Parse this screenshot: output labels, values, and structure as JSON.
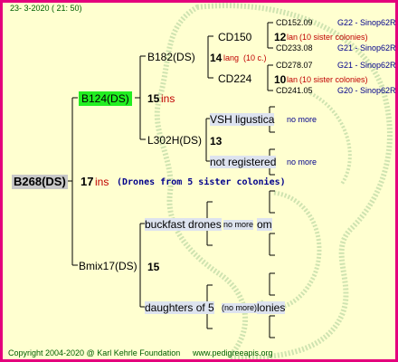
{
  "header": {
    "date": "23- 3-2020 ( 21: 50)"
  },
  "root": {
    "id": "B268(DS)",
    "num": "17",
    "suffix": "ins",
    "note": "(Drones from 5 sister colonies)"
  },
  "queen": {
    "id": "B124(DS)",
    "num": "15",
    "suffix": "ins"
  },
  "queen_mother": {
    "id": "B182(DS)",
    "num": "14",
    "suffix": "lang",
    "note": "(10 c.)"
  },
  "queen_father": {
    "id": "L302H(DS)",
    "num": "13"
  },
  "qm_mother": {
    "id": "CD150",
    "num": "12",
    "suffix": "lan",
    "note": "(10 sister colonies)"
  },
  "qm_father": {
    "id": "CD224",
    "num": "10",
    "suffix": "lan",
    "note": "(10 sister colonies)"
  },
  "great": [
    {
      "id": "CD152.09",
      "ref": "G22 - Sinop62R"
    },
    {
      "id": "CD233.08",
      "ref": "G21 - Sinop62R"
    },
    {
      "id": "CD278.07",
      "ref": "G21 - Sinop62R"
    },
    {
      "id": "CD241.05",
      "ref": "G20 - Sinop62R"
    }
  ],
  "qf_mother": {
    "id": "VSH ligustica",
    "more": "no more"
  },
  "qf_father": {
    "id": "not registered",
    "more": "no more"
  },
  "drone_side": {
    "id": "Bmix17(DS)",
    "num": "15"
  },
  "drone_mother": {
    "id": "buckfast drones",
    "more": "no more",
    "tail": "om"
  },
  "drone_father": {
    "id": "daughters of 5",
    "more": "(no more)",
    "tail": "lonies"
  },
  "footer": {
    "copyright": "Copyright 2004-2020 @ Karl Kehrle Foundation",
    "site": "www.pedigreeapis.org"
  }
}
